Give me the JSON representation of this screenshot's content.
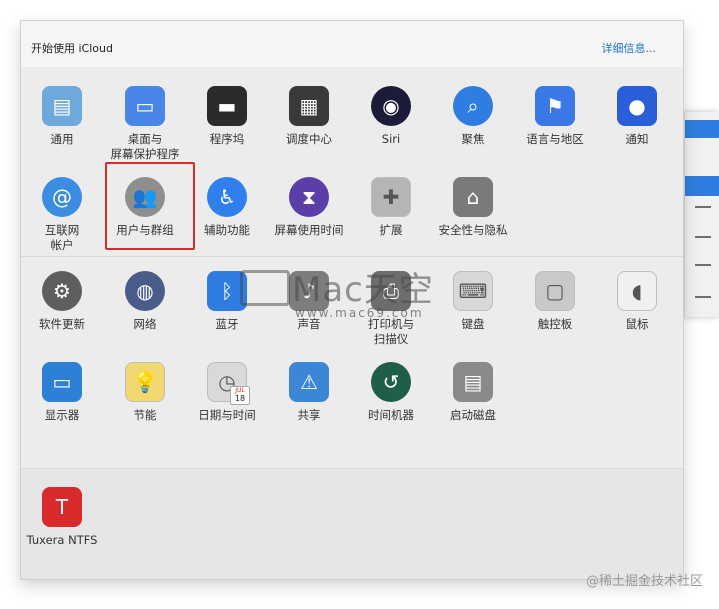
{
  "header": {
    "title": "开始使用 iCloud",
    "details_link": "详细信息..."
  },
  "row1": [
    {
      "name": "pane-general",
      "label": "通用",
      "icon": "general-icon",
      "color": "#6fa8dc"
    },
    {
      "name": "pane-desktop",
      "label": "桌面与\n屏幕保护程序",
      "icon": "desktop-screensaver-icon",
      "color": "#4a86e8"
    },
    {
      "name": "pane-dock",
      "label": "程序坞",
      "icon": "dock-icon",
      "color": "#2b2b2b"
    },
    {
      "name": "pane-mission-control",
      "label": "调度中心",
      "icon": "mission-control-icon",
      "color": "#3a3a3a"
    },
    {
      "name": "pane-siri",
      "label": "Siri",
      "icon": "siri-icon",
      "color": "#1c1c3a"
    },
    {
      "name": "pane-spotlight",
      "label": "聚焦",
      "icon": "spotlight-icon",
      "color": "#2f7de1"
    },
    {
      "name": "pane-language",
      "label": "语言与地区",
      "icon": "language-region-icon",
      "color": "#3b78e7"
    },
    {
      "name": "pane-notifications",
      "label": "通知",
      "icon": "notifications-icon",
      "color": "#2b5fd9"
    }
  ],
  "row2": [
    {
      "name": "pane-internet-accounts",
      "label": "互联网\n帐户",
      "icon": "internet-accounts-icon",
      "color": "#3a8de0"
    },
    {
      "name": "pane-users-groups",
      "label": "用户与群组",
      "icon": "users-groups-icon",
      "color": "#8e8e8e"
    },
    {
      "name": "pane-accessibility",
      "label": "辅助功能",
      "icon": "accessibility-icon",
      "color": "#2f80ed"
    },
    {
      "name": "pane-screen-time",
      "label": "屏幕使用时间",
      "icon": "screen-time-icon",
      "color": "#5b3ea8"
    },
    {
      "name": "pane-extensions",
      "label": "扩展",
      "icon": "extensions-icon",
      "color": "#b5b5b5"
    },
    {
      "name": "pane-security",
      "label": "安全性与隐私",
      "icon": "security-privacy-icon",
      "color": "#7a7a7a"
    }
  ],
  "row3": [
    {
      "name": "pane-software-update",
      "label": "软件更新",
      "icon": "software-update-icon",
      "color": "#5e5e5e"
    },
    {
      "name": "pane-network",
      "label": "网络",
      "icon": "network-icon",
      "color": "#4a5d8a"
    },
    {
      "name": "pane-bluetooth",
      "label": "蓝牙",
      "icon": "bluetooth-icon",
      "color": "#2f7de1"
    },
    {
      "name": "pane-sound",
      "label": "声音",
      "icon": "sound-icon",
      "color": "#7d7d7d"
    },
    {
      "name": "pane-printers",
      "label": "打印机与\n扫描仪",
      "icon": "printers-scanners-icon",
      "color": "#6d6d6d"
    },
    {
      "name": "pane-keyboard",
      "label": "键盘",
      "icon": "keyboard-icon",
      "color": "#d8d8d8"
    },
    {
      "name": "pane-trackpad",
      "label": "触控板",
      "icon": "trackpad-icon",
      "color": "#c9c9c9"
    },
    {
      "name": "pane-mouse",
      "label": "鼠标",
      "icon": "mouse-icon",
      "color": "#f0f0f0"
    }
  ],
  "row4": [
    {
      "name": "pane-displays",
      "label": "显示器",
      "icon": "displays-icon",
      "color": "#2d7fd8"
    },
    {
      "name": "pane-energy-saver",
      "label": "节能",
      "icon": "energy-saver-icon",
      "color": "#f3d870"
    },
    {
      "name": "pane-date-time",
      "label": "日期与时间",
      "icon": "date-time-icon",
      "color": "#d9d9d9"
    },
    {
      "name": "pane-sharing",
      "label": "共享",
      "icon": "sharing-icon",
      "color": "#3b86d6"
    },
    {
      "name": "pane-time-machine",
      "label": "时间机器",
      "icon": "time-machine-icon",
      "color": "#1f5f4a"
    },
    {
      "name": "pane-startup-disk",
      "label": "启动磁盘",
      "icon": "startup-disk-icon",
      "color": "#8a8a8a"
    }
  ],
  "row5": [
    {
      "name": "pane-tuxera",
      "label": "Tuxera NTFS",
      "icon": "tuxera-icon",
      "color": "#d92b2b"
    }
  ],
  "calendar_badge": {
    "month": "JUL",
    "day": "18"
  },
  "watermark": {
    "big": "Mac天空",
    "small": "www.mac69.com"
  },
  "credit": "@稀土掘金技术社区"
}
